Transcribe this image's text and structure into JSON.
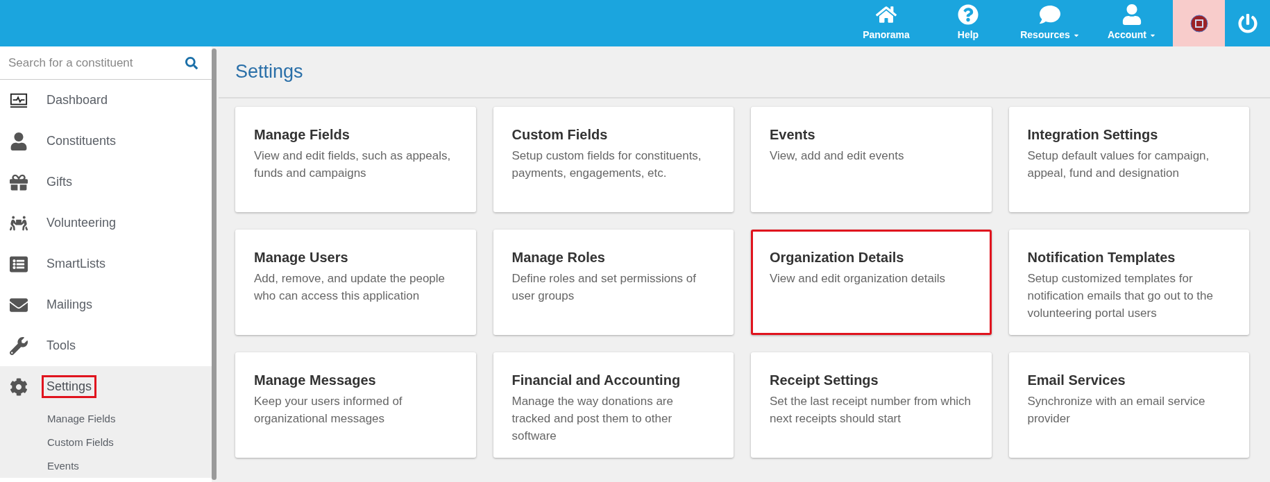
{
  "top_bar": {
    "items": [
      {
        "label": "Panorama",
        "dropdown": false
      },
      {
        "label": "Help",
        "dropdown": false
      },
      {
        "label": "Resources",
        "dropdown": true
      },
      {
        "label": "Account",
        "dropdown": true
      }
    ],
    "record_active": true
  },
  "sidebar": {
    "search": {
      "placeholder": "Search for a constituent"
    },
    "items": [
      {
        "label": "Dashboard",
        "selected": false,
        "highlighted": false
      },
      {
        "label": "Constituents",
        "selected": false,
        "highlighted": false
      },
      {
        "label": "Gifts",
        "selected": false,
        "highlighted": false
      },
      {
        "label": "Volunteering",
        "selected": false,
        "highlighted": false
      },
      {
        "label": "SmartLists",
        "selected": false,
        "highlighted": false
      },
      {
        "label": "Mailings",
        "selected": false,
        "highlighted": false
      },
      {
        "label": "Tools",
        "selected": false,
        "highlighted": false
      },
      {
        "label": "Settings",
        "selected": true,
        "highlighted": true,
        "children": [
          {
            "label": "Manage Fields"
          },
          {
            "label": "Custom Fields"
          },
          {
            "label": "Events"
          }
        ]
      }
    ]
  },
  "page": {
    "title": "Settings",
    "cards": [
      {
        "title": "Manage Fields",
        "description": "View and edit fields, such as appeals, funds and campaigns",
        "highlighted": false
      },
      {
        "title": "Custom Fields",
        "description": "Setup custom fields for constituents, payments, engagements, etc.",
        "highlighted": false
      },
      {
        "title": "Events",
        "description": "View, add and edit events",
        "highlighted": false
      },
      {
        "title": "Integration Settings",
        "description": "Setup default values for campaign, appeal, fund and designation",
        "highlighted": false
      },
      {
        "title": "Manage Users",
        "description": "Add, remove, and update the people who can access this application",
        "highlighted": false
      },
      {
        "title": "Manage Roles",
        "description": "Define roles and set permissions of user groups",
        "highlighted": false
      },
      {
        "title": "Organization Details",
        "description": "View and edit organization details",
        "highlighted": true
      },
      {
        "title": "Notification Templates",
        "description": "Setup customized templates for notification emails that go out to the volunteering portal users",
        "highlighted": false
      },
      {
        "title": "Manage Messages",
        "description": "Keep your users informed of organizational messages",
        "highlighted": false
      },
      {
        "title": "Financial and Accounting",
        "description": "Manage the way donations are tracked and post them to other software",
        "highlighted": false
      },
      {
        "title": "Receipt Settings",
        "description": "Set the last receipt number from which next receipts should start",
        "highlighted": false
      },
      {
        "title": "Email Services",
        "description": "Synchronize with an email service provider",
        "highlighted": false
      }
    ]
  }
}
